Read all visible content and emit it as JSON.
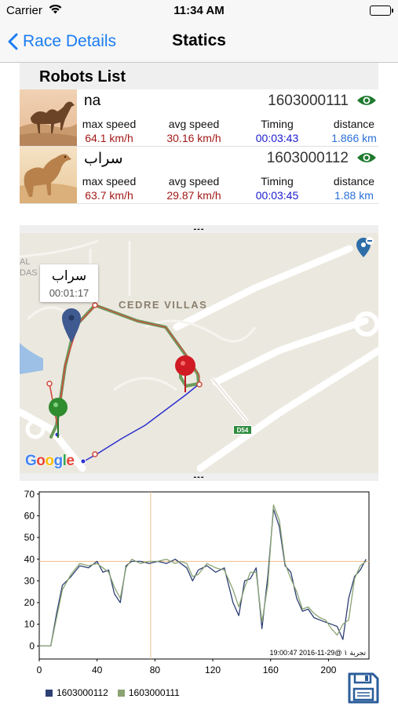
{
  "status_bar": {
    "carrier": "Carrier",
    "time": "11:34 AM"
  },
  "nav": {
    "back_label": "Race Details",
    "title": "Statics"
  },
  "robots_list": {
    "title": "Robots List",
    "robots": [
      {
        "name": "na",
        "id": "1603000111",
        "stats": [
          {
            "label": "max speed",
            "value": "64.1 km/h"
          },
          {
            "label": "avg speed",
            "value": "30.16 km/h"
          },
          {
            "label": "Timing",
            "value": "00:03:43"
          },
          {
            "label": "distance",
            "value": "1.866 km"
          }
        ]
      },
      {
        "name": "سراب",
        "id": "1603000112",
        "stats": [
          {
            "label": "max speed",
            "value": "63.7 km/h"
          },
          {
            "label": "avg speed",
            "value": "29.87 km/h"
          },
          {
            "label": "Timing",
            "value": "00:03:45"
          },
          {
            "label": "distance",
            "value": "1.88 km"
          }
        ]
      }
    ]
  },
  "map": {
    "handle_top": "---",
    "handle_bottom": "---",
    "callout": {
      "name": "سراب",
      "time": "00:01:17"
    },
    "area_label": "CEDRE VILLAS",
    "road_tag": "D54",
    "side_text": "AL\nDAS",
    "attribution": "Google",
    "icons": [
      "map-pin-icon",
      "remove-pin-icon"
    ]
  },
  "chart_data": {
    "type": "line",
    "x_ticks": [
      "0",
      "40",
      "80",
      "120",
      "160",
      "200"
    ],
    "y_ticks": [
      "0",
      "10",
      "20",
      "30",
      "40",
      "50",
      "60",
      "70"
    ],
    "xlim": [
      0,
      228
    ],
    "ylim": [
      -6,
      71
    ],
    "crosshair": {
      "x": 77,
      "y": 39
    },
    "timestamp": "تجربة ١ @29-11-2016 19:00:47",
    "series": [
      {
        "name": "1603000112",
        "color": "#2d3f73",
        "x": [
          0,
          8,
          12,
          16,
          22,
          28,
          34,
          40,
          44,
          48,
          52,
          56,
          60,
          64,
          70,
          76,
          82,
          88,
          94,
          98,
          102,
          106,
          110,
          116,
          122,
          128,
          134,
          138,
          142,
          146,
          150,
          154,
          158,
          162,
          166,
          170,
          174,
          178,
          182,
          186,
          190,
          194,
          198,
          202,
          206,
          210,
          214,
          218,
          222,
          226
        ],
        "y": [
          0,
          0,
          15,
          28,
          32,
          37,
          36,
          39,
          34,
          35,
          24,
          20,
          37,
          39,
          39,
          38,
          39,
          38,
          40,
          38,
          36,
          30,
          35,
          37,
          34,
          36,
          20,
          14,
          30,
          31,
          36,
          8,
          32,
          63,
          55,
          37,
          34,
          22,
          16,
          17,
          13,
          12,
          11,
          10,
          9,
          3,
          22,
          32,
          35,
          40
        ]
      },
      {
        "name": "1603000111",
        "color": "#8aa373",
        "x": [
          0,
          8,
          12,
          16,
          22,
          28,
          34,
          40,
          44,
          48,
          52,
          56,
          60,
          64,
          70,
          76,
          82,
          88,
          94,
          98,
          102,
          106,
          110,
          116,
          122,
          128,
          134,
          138,
          142,
          146,
          150,
          154,
          158,
          162,
          166,
          170,
          174,
          178,
          182,
          186,
          190,
          194,
          198,
          202,
          206,
          210,
          214,
          218,
          222,
          226
        ],
        "y": [
          0,
          0,
          13,
          26,
          33,
          38,
          37,
          38,
          36,
          34,
          27,
          22,
          36,
          40,
          38,
          39,
          39,
          40,
          38,
          39,
          38,
          32,
          33,
          38,
          36,
          35,
          26,
          18,
          27,
          34,
          34,
          11,
          28,
          65,
          58,
          38,
          31,
          25,
          17,
          18,
          15,
          13,
          12,
          8,
          5,
          10,
          12,
          31,
          37,
          39
        ]
      }
    ]
  }
}
